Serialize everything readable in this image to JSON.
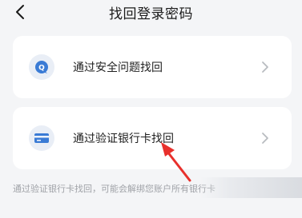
{
  "header": {
    "title": "找回登录密码",
    "back_icon": "chevron-left-icon"
  },
  "options": [
    {
      "label": "通过安全问题找回",
      "icon": "question-bubble-icon",
      "chevron": "chevron-right-icon"
    },
    {
      "label": "通过验证银行卡找回",
      "icon": "bank-card-icon",
      "chevron": "chevron-right-icon"
    }
  ],
  "note": "通过验证银行卡找回，可能会解绑您账户所有银行卡",
  "colors": {
    "background": "#f4f5f7",
    "card": "#ffffff",
    "icon_bg": "#e9eef6",
    "icon_blue": "#3a7bd5",
    "annotation_red": "#e8302c",
    "note_text": "#a0a3a8"
  },
  "annotation": {
    "icon": "red-arrow-icon"
  }
}
